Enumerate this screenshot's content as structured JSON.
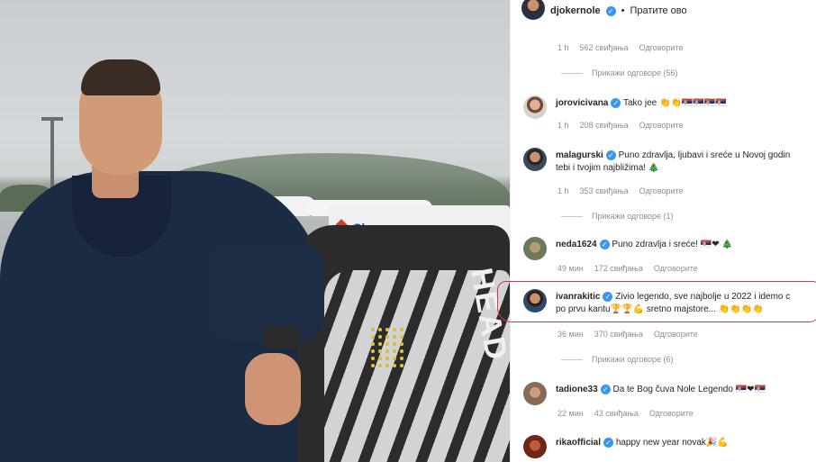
{
  "post": {
    "author": "djokernole",
    "follow_separator": "•",
    "follow_label": "Пратите ово",
    "header_meta": {
      "time": "1 h",
      "likes": "562 свиђања",
      "reply": "Одговорите"
    },
    "header_replies": "Прикажи одговоре (56)"
  },
  "comments": [
    {
      "user": "jorovicivana",
      "text": "Tako jee 👏👏🇷🇸🇷🇸🇷🇸🇷🇸",
      "time": "1 h",
      "likes": "208 свиђања",
      "reply": "Одговорите"
    },
    {
      "user": "malagurski",
      "text": "Puno zdravlja, ljubavi i sreće u Novoj godin",
      "text2": "tebi i tvojim najbližima! 🎄",
      "time": "1 h",
      "likes": "353 свиђања",
      "reply": "Одговорите",
      "replies": "Прикажи одговоре (1)"
    },
    {
      "user": "neda1624",
      "text": "Puno zdravlja i sreće! 🇷🇸❤ 🎄",
      "time": "49 мин",
      "likes": "172 свиђања",
      "reply": "Одговорите"
    },
    {
      "user": "ivanrakitic",
      "text": "Zivio legendo, sve najbolje u 2022 i idemo c",
      "text2": "po prvu kantu🏆🏆💪 sretno majstore... 👏👏👏👏",
      "time": "36 мин",
      "likes": "370 свиђања",
      "reply": "Одговорите",
      "replies": "Прикажи одговоре (6)"
    },
    {
      "user": "tadione33",
      "text": "Da te Bog čuva Nole Legendo 🇷🇸❤🇷🇸",
      "time": "22 мин",
      "likes": "43 свиђања",
      "reply": "Одговорите"
    },
    {
      "user": "rikaofficial",
      "text": "happy new year novak🎉💪",
      "time": "",
      "likes": "",
      "reply": ""
    }
  ],
  "photo": {
    "truck_text": "Sk",
    "bag_text": "HEAD"
  },
  "colors": {
    "verified": "#3897f0",
    "highlight": "#d23a3a",
    "meta_text": "#8e8e8e"
  },
  "icons": [
    "verified-badge-icon"
  ]
}
